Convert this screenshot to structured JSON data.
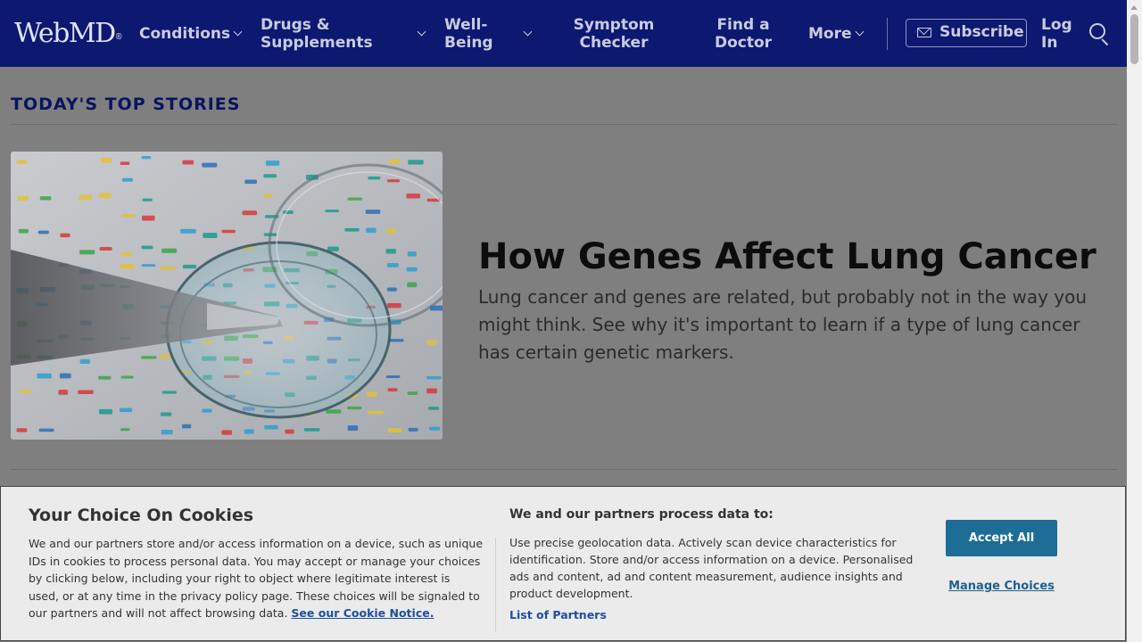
{
  "header": {
    "logo": "WebMD",
    "logo_mark": "®",
    "nav": [
      {
        "label": "Conditions"
      },
      {
        "label": "Drugs & Supplements"
      },
      {
        "label": "Well-Being"
      },
      {
        "label": "Symptom Checker"
      },
      {
        "label": "Find a Doctor"
      },
      {
        "label": "More"
      }
    ],
    "subscribe_label": "Subscribe",
    "login_label": "Log In",
    "icons": [
      "chevron-down-icon",
      "mail-icon",
      "search-icon"
    ],
    "background_color": "#0d1871"
  },
  "main": {
    "section_title": "TODAY'S TOP STORIES",
    "story": {
      "headline": "How Genes Affect Lung Cancer",
      "summary": "Lung cancer and genes are related, but probably not in the way you might think. See why it's important to learn if a type of lung cancer has certain genetic markers."
    }
  },
  "cookie_banner": {
    "title": "Your Choice On Cookies",
    "body": "We and our partners store and/or access information on a device, such as unique IDs in cookies to process personal data. You may accept or manage your choices by clicking below, including your right to object where legitimate interest is used, or at any time in the privacy policy page. These choices will be signaled to our partners and will not affect browsing data.",
    "notice_link": "See our Cookie Notice.",
    "process_title": "We and our partners process data to:",
    "process_body": "Use precise geolocation data. Actively scan device characteristics for identification. Store and/or access information on a device. Personalised ads and content, ad and content measurement, audience insights and product development.",
    "partners_link": "List of Partners",
    "accept_label": "Accept All",
    "manage_label": "Manage Choices",
    "accent_color": "#1e6d96"
  }
}
